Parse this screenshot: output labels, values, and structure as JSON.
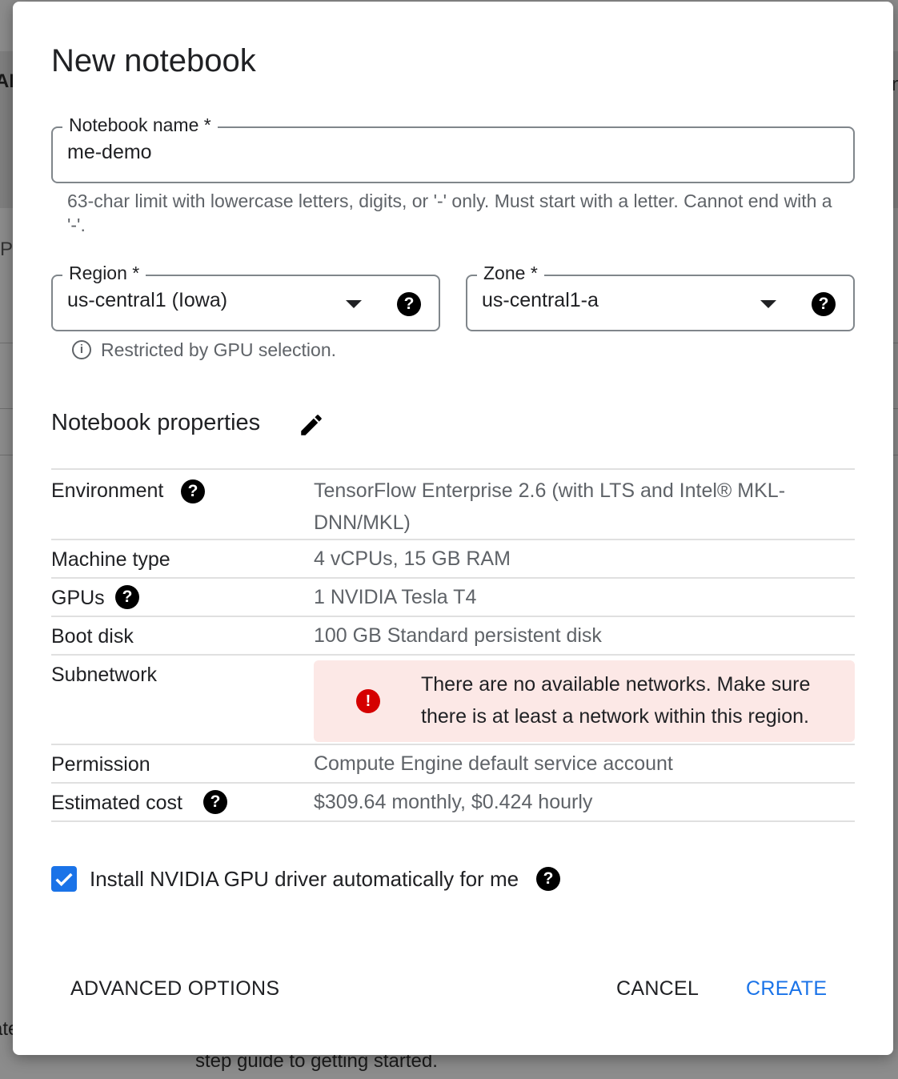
{
  "background": {
    "fragments": [
      "AP",
      "P",
      "n",
      "ate",
      "step guide to getting started."
    ]
  },
  "dialog": {
    "title": "New notebook",
    "notebook_name": {
      "label": "Notebook name *",
      "value": "me-demo",
      "hint": "63-char limit with lowercase letters, digits, or '-' only. Must start with a letter. Cannot end with a '-'."
    },
    "region": {
      "label": "Region *",
      "value": "us-central1 (Iowa)"
    },
    "zone": {
      "label": "Zone *",
      "value": "us-central1-a"
    },
    "restriction_note": "Restricted by GPU selection.",
    "properties_title": "Notebook properties",
    "properties": {
      "environment": {
        "label": "Environment",
        "value": "TensorFlow Enterprise 2.6 (with LTS and Intel® MKL-DNN/MKL)"
      },
      "machine_type": {
        "label": "Machine type",
        "value": "4 vCPUs, 15 GB RAM"
      },
      "gpus": {
        "label": "GPUs",
        "value": "1 NVIDIA Tesla T4"
      },
      "boot_disk": {
        "label": "Boot disk",
        "value": "100 GB Standard persistent disk"
      },
      "subnetwork": {
        "label": "Subnetwork",
        "error": "There are no available networks. Make sure there is at least a network within this region."
      },
      "permission": {
        "label": "Permission",
        "value": "Compute Engine default service account"
      },
      "estimated_cost": {
        "label": "Estimated cost",
        "value": "$309.64 monthly, $0.424 hourly"
      }
    },
    "gpu_driver": {
      "label": "Install NVIDIA GPU driver automatically for me",
      "checked": true
    },
    "buttons": {
      "advanced": "ADVANCED OPTIONS",
      "cancel": "CANCEL",
      "create": "CREATE"
    }
  },
  "colors": {
    "accent": "#1a73e8",
    "error": "#d50000",
    "error_bg": "#fce8e6",
    "secondary_text": "#5f6368"
  }
}
